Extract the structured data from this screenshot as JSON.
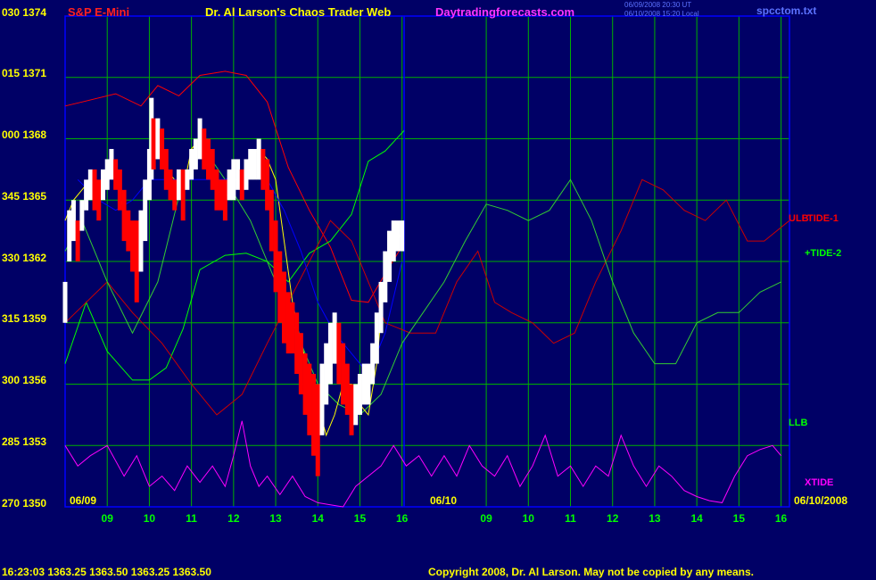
{
  "header": {
    "symbol": "S&P E-Mini",
    "title": "Dr. Al Larson's Chaos Trader Web",
    "site": "Daytradingforecasts.com",
    "ts1": "06/09/2008 20:30 UT",
    "ts2": "06/10/2008 15:20 Local",
    "file": "spcctom.txt"
  },
  "footer": {
    "quote": "16:23:03  1363.25  1363.50  1363.25  1363.50",
    "copyright": "Copyright 2008, Dr. Al Larson. May not be copied by any means."
  },
  "chart_data": {
    "type": "line",
    "title": "S&P E-Mini",
    "y_labels": [
      "030 1374",
      "015 1371",
      "000 1368",
      "345 1365",
      "330 1362",
      "315 1359",
      "300 1356",
      "285 1353",
      "270 1350"
    ],
    "ylim": [
      1350,
      1374
    ],
    "x_ticks": [
      "09",
      "10",
      "11",
      "12",
      "13",
      "14",
      "15",
      "16",
      "09",
      "10",
      "11",
      "12",
      "13",
      "14",
      "15",
      "16"
    ],
    "x_hours": [
      9,
      10,
      11,
      12,
      13,
      14,
      15,
      16,
      18,
      19,
      20,
      21,
      22,
      23,
      24,
      25
    ],
    "xlim": [
      8,
      25.2
    ],
    "date_labels": [
      "06/09",
      "06/10",
      "06/10/2008"
    ],
    "grid": true,
    "colors": {
      "background": "#000066",
      "grid": "#00b000",
      "price": "#ff0000",
      "price_up": "#ffffff",
      "avg": "#ffff00",
      "ulb": "#ff0000",
      "llb": "#00ff00",
      "tide1": "#cc0000",
      "tide2": "#33cc33",
      "xtide": "#ff00ff",
      "now_line": "#0000ff"
    },
    "series": [
      {
        "name": "ULB",
        "x": [
          8.0,
          8.4,
          9.2,
          9.8,
          10.2,
          10.7,
          11.2,
          11.8,
          12.3,
          12.8,
          13.3,
          13.8,
          14.3,
          14.8,
          15.2,
          15.6,
          16.05
        ],
        "y": [
          1369.6,
          1369.8,
          1370.2,
          1369.6,
          1370.6,
          1370.1,
          1371.1,
          1371.3,
          1371.1,
          1369.8,
          1366.6,
          1364.5,
          1362.7,
          1360.1,
          1360.0,
          1361.4,
          1362.9
        ]
      },
      {
        "name": "LLB",
        "x": [
          8.0,
          8.5,
          9.0,
          9.6,
          10.0,
          10.4,
          10.8,
          11.2,
          11.8,
          12.3,
          12.8,
          13.3,
          13.8,
          14.3,
          14.8,
          15.2,
          15.6,
          16.05
        ],
        "y": [
          1357.0,
          1360.0,
          1357.6,
          1356.2,
          1356.2,
          1356.8,
          1358.7,
          1361.6,
          1362.3,
          1362.4,
          1362.0,
          1361.0,
          1362.4,
          1363.0,
          1364.3,
          1366.9,
          1367.4,
          1368.4
        ]
      },
      {
        "name": "TIDE-1",
        "x": [
          8.0,
          9.0,
          9.6,
          10.3,
          11.0,
          11.6,
          12.2,
          12.8,
          13.3,
          13.8,
          14.3,
          14.8,
          15.2,
          15.6,
          16.2,
          16.8,
          17.3,
          17.8,
          18.2,
          18.6,
          19.1,
          19.6,
          20.1,
          20.6,
          21.2,
          21.7,
          22.2,
          22.7,
          23.2,
          23.7,
          24.2,
          24.6,
          25.2
        ],
        "y": [
          1359.0,
          1361.0,
          1359.5,
          1358.0,
          1356.0,
          1354.5,
          1355.5,
          1358.0,
          1360.0,
          1362.0,
          1364.0,
          1363.0,
          1361.0,
          1359.0,
          1358.5,
          1358.5,
          1361.0,
          1362.5,
          1360.0,
          1359.5,
          1359.0,
          1358.0,
          1358.5,
          1361.0,
          1363.5,
          1366.0,
          1365.5,
          1364.5,
          1364.0,
          1365.0,
          1363.0,
          1363.0,
          1364.0
        ]
      },
      {
        "name": "TIDE-2",
        "x": [
          8.0,
          8.4,
          9.0,
          9.6,
          10.2,
          10.8,
          11.3,
          11.8,
          12.4,
          13.0,
          13.5,
          14.0,
          14.5,
          15.0,
          15.5,
          16.0,
          16.5,
          17.0,
          17.5,
          18.0,
          18.5,
          19.0,
          19.5,
          20.0,
          20.5,
          21.0,
          21.5,
          22.0,
          22.5,
          23.0,
          23.5,
          24.0,
          24.5,
          25.0
        ],
        "y": [
          1362.5,
          1364.0,
          1361.0,
          1358.5,
          1361.0,
          1366.0,
          1367.5,
          1366.0,
          1364.0,
          1361.0,
          1358.5,
          1356.0,
          1355.0,
          1354.5,
          1355.5,
          1358.0,
          1359.5,
          1361.0,
          1363.0,
          1364.8,
          1364.5,
          1364.0,
          1364.5,
          1366.0,
          1364.0,
          1361.0,
          1358.5,
          1357.0,
          1357.0,
          1359.0,
          1359.5,
          1359.5,
          1360.5,
          1361.0
        ]
      },
      {
        "name": "XTIDE",
        "x": [
          8.0,
          8.3,
          8.6,
          9.0,
          9.4,
          9.7,
          10.0,
          10.3,
          10.6,
          10.9,
          11.2,
          11.5,
          11.8,
          12.0,
          12.2,
          12.4,
          12.6,
          12.8,
          13.1,
          13.4,
          13.7,
          14.0,
          14.3,
          14.6,
          14.9,
          15.2,
          15.5,
          15.8,
          16.1,
          16.4,
          16.7,
          17.0,
          17.3,
          17.6,
          17.9,
          18.2,
          18.5,
          18.8,
          19.1,
          19.4,
          19.7,
          20.0,
          20.3,
          20.6,
          20.9,
          21.2,
          21.5,
          21.8,
          22.1,
          22.4,
          22.7,
          23.0,
          23.3,
          23.6,
          23.9,
          24.2,
          24.5,
          24.8,
          25.0
        ],
        "y": [
          1353.0,
          1352.0,
          1352.5,
          1353.0,
          1351.5,
          1352.5,
          1351.0,
          1351.5,
          1350.8,
          1352.0,
          1351.2,
          1352.0,
          1351.0,
          1352.5,
          1354.2,
          1352.0,
          1351.0,
          1351.5,
          1350.6,
          1351.5,
          1350.5,
          1350.2,
          1350.1,
          1350.0,
          1351.0,
          1351.5,
          1352.0,
          1353.0,
          1352.0,
          1352.5,
          1351.5,
          1352.5,
          1351.5,
          1353.0,
          1352.0,
          1351.5,
          1352.5,
          1351.0,
          1352.0,
          1353.5,
          1351.5,
          1352.0,
          1351.0,
          1352.0,
          1351.5,
          1353.5,
          1352.0,
          1351.0,
          1352.0,
          1351.5,
          1350.8,
          1350.5,
          1350.3,
          1350.2,
          1351.5,
          1352.5,
          1352.8,
          1353.0,
          1352.5
        ]
      },
      {
        "name": "",
        "x": [
          8.0,
          8.2,
          8.4,
          8.6,
          8.8,
          9.0,
          9.2,
          9.4,
          9.5,
          9.6,
          9.7,
          9.8,
          10.0,
          10.2,
          10.4,
          10.6,
          10.8,
          11.0,
          11.2,
          11.4,
          11.6,
          11.8,
          12.0,
          12.2,
          12.4,
          12.6,
          12.8,
          13.0,
          13.2,
          13.4,
          13.6,
          13.8,
          14.0,
          14.2,
          14.4,
          14.6,
          14.8,
          15.0,
          15.2,
          15.4,
          15.6,
          15.8,
          16.0
        ],
        "y": [
          1364.0,
          1365.0,
          1365.5,
          1366.0,
          1365.5,
          1366.5,
          1366.0,
          1364.5,
          1364.0,
          1363.5,
          1363.0,
          1363.5,
          1366.5,
          1368.0,
          1366.5,
          1366.0,
          1365.5,
          1367.5,
          1368.0,
          1367.0,
          1365.5,
          1365.0,
          1366.0,
          1366.0,
          1367.0,
          1367.5,
          1367.0,
          1366.0,
          1363.0,
          1360.0,
          1358.0,
          1356.5,
          1355.0,
          1353.5,
          1354.5,
          1356.0,
          1356.0,
          1355.0,
          1354.5,
          1357.0,
          1361.5,
          1362.5,
          1363.5
        ]
      },
      {
        "name": "",
        "x": [
          8.3,
          8.8,
          9.2,
          9.6,
          10.0,
          10.6,
          11.2,
          11.8,
          12.3,
          12.8,
          13.2,
          13.6,
          14.0,
          14.4,
          14.8,
          15.2,
          15.6,
          16.0
        ],
        "y": [
          1366.0,
          1365.0,
          1364.5,
          1365.0,
          1366.0,
          1366.0,
          1366.0,
          1366.0,
          1366.5,
          1366.0,
          1364.5,
          1362.5,
          1360.0,
          1358.5,
          1357.5,
          1356.5,
          1358.5,
          1362.0
        ]
      }
    ],
    "price_bars": [
      [
        8.0,
        1361,
        1359
      ],
      [
        8.1,
        1364.5,
        1362
      ],
      [
        8.2,
        1365,
        1363
      ],
      [
        8.3,
        1364,
        1362
      ],
      [
        8.4,
        1365,
        1363.5
      ],
      [
        8.5,
        1366,
        1364.5
      ],
      [
        8.6,
        1366.5,
        1365
      ],
      [
        8.7,
        1366.5,
        1364.5
      ],
      [
        8.8,
        1366,
        1364
      ],
      [
        8.9,
        1366.5,
        1365
      ],
      [
        9.0,
        1367,
        1365.5
      ],
      [
        9.1,
        1367.5,
        1366
      ],
      [
        9.2,
        1367,
        1365.5
      ],
      [
        9.3,
        1366.5,
        1364.5
      ],
      [
        9.4,
        1365.5,
        1363
      ],
      [
        9.5,
        1364.5,
        1362.5
      ],
      [
        9.6,
        1364,
        1361.5
      ],
      [
        9.7,
        1364,
        1360
      ],
      [
        9.8,
        1364.5,
        1361.5
      ],
      [
        9.9,
        1366,
        1363
      ],
      [
        10.0,
        1367.5,
        1365
      ],
      [
        10.05,
        1370,
        1366
      ],
      [
        10.1,
        1369,
        1366.5
      ],
      [
        10.2,
        1369,
        1367
      ],
      [
        10.3,
        1368.5,
        1366.5
      ],
      [
        10.4,
        1367.5,
        1365.5
      ],
      [
        10.5,
        1366.5,
        1365
      ],
      [
        10.6,
        1366,
        1364.5
      ],
      [
        10.7,
        1366.5,
        1365
      ],
      [
        10.8,
        1366.5,
        1364
      ],
      [
        10.9,
        1366.5,
        1365.5
      ],
      [
        11.0,
        1367.5,
        1366
      ],
      [
        11.1,
        1368,
        1366.5
      ],
      [
        11.2,
        1369,
        1367
      ],
      [
        11.3,
        1368.5,
        1366.5
      ],
      [
        11.4,
        1368,
        1366
      ],
      [
        11.5,
        1367.5,
        1365.5
      ],
      [
        11.6,
        1366.5,
        1364.5
      ],
      [
        11.7,
        1366,
        1364.5
      ],
      [
        11.8,
        1366,
        1364
      ],
      [
        11.9,
        1366.5,
        1365
      ],
      [
        12.0,
        1367,
        1365
      ],
      [
        12.1,
        1367,
        1365.5
      ],
      [
        12.2,
        1366.5,
        1365
      ],
      [
        12.3,
        1367,
        1365.5
      ],
      [
        12.4,
        1367.5,
        1366
      ],
      [
        12.5,
        1367.5,
        1366
      ],
      [
        12.6,
        1368,
        1366
      ],
      [
        12.7,
        1367.5,
        1365.5
      ],
      [
        12.8,
        1367,
        1364.5
      ],
      [
        12.9,
        1365.5,
        1362.5
      ],
      [
        13.0,
        1364,
        1360.5
      ],
      [
        13.1,
        1362.5,
        1359
      ],
      [
        13.2,
        1361.5,
        1358
      ],
      [
        13.3,
        1360.5,
        1357.5
      ],
      [
        13.4,
        1360,
        1357.5
      ],
      [
        13.5,
        1359.5,
        1356.5
      ],
      [
        13.6,
        1358.5,
        1355.5
      ],
      [
        13.7,
        1357.5,
        1354.5
      ],
      [
        13.8,
        1357,
        1353.5
      ],
      [
        13.9,
        1356.5,
        1352.5
      ],
      [
        14.0,
        1356,
        1351.5
      ],
      [
        14.1,
        1357,
        1353.5
      ],
      [
        14.2,
        1358,
        1355
      ],
      [
        14.3,
        1359,
        1356
      ],
      [
        14.4,
        1359.5,
        1357
      ],
      [
        14.5,
        1359,
        1356
      ],
      [
        14.6,
        1358,
        1355
      ],
      [
        14.7,
        1357,
        1354.5
      ],
      [
        14.8,
        1356,
        1353.5
      ],
      [
        14.9,
        1356,
        1354
      ],
      [
        15.0,
        1356.5,
        1354.5
      ],
      [
        15.1,
        1357,
        1355
      ],
      [
        15.2,
        1357,
        1355
      ],
      [
        15.3,
        1358,
        1356
      ],
      [
        15.4,
        1359.5,
        1357
      ],
      [
        15.5,
        1361,
        1358.5
      ],
      [
        15.6,
        1362.5,
        1360
      ],
      [
        15.7,
        1363.5,
        1361
      ],
      [
        15.8,
        1364,
        1362
      ],
      [
        15.9,
        1364,
        1362.5
      ],
      [
        16.0,
        1364,
        1362.5
      ]
    ],
    "right_labels": [
      {
        "text": "ULB",
        "y": 1364.0,
        "color": "#ff0000"
      },
      {
        "text": "TIDE-1",
        "y": 1364.0,
        "color": "#ff0000"
      },
      {
        "text": "+TIDE-2",
        "y": 1362.3,
        "color": "#00ff00"
      },
      {
        "text": "LLB",
        "y": 1354.0,
        "color": "#00ff00"
      },
      {
        "text": "XTIDE",
        "y": 1351.1,
        "color": "#ff00ff"
      }
    ]
  }
}
